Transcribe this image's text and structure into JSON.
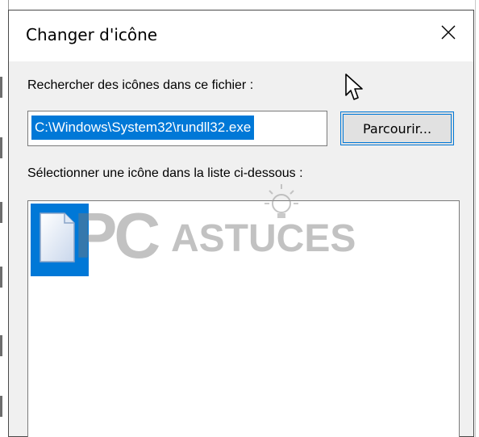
{
  "dialog": {
    "title": "Changer d'icône",
    "close_icon": "close-icon"
  },
  "form": {
    "search_label": "Rechercher des icônes dans ce fichier :",
    "file_path": "C:\\Windows\\System32\\rundll32.exe",
    "browse_label": "Parcourir...",
    "select_label": "Sélectionner une icône dans la liste ci-dessous :"
  },
  "icon_list": {
    "items": [
      {
        "icon": "blank-document-icon",
        "selected": true
      }
    ]
  },
  "watermark": {
    "brand": "PC",
    "brand_suffix": "ASTUCES",
    "icon": "lightbulb-icon"
  },
  "colors": {
    "selection": "#0078d7",
    "dialog_bg": "#f0f0f0",
    "button_bg": "#e1e1e1"
  }
}
